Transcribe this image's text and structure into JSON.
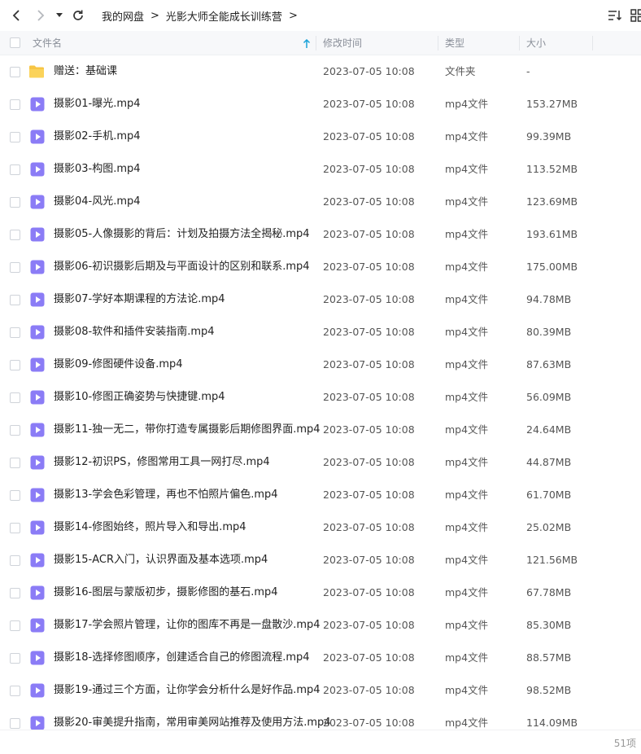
{
  "breadcrumb": [
    "我的网盘",
    "光影大师全能成长训练营"
  ],
  "header": {
    "name": "文件名",
    "mtime": "修改时间",
    "type": "类型",
    "size": "大小"
  },
  "colors": {
    "sort_arrow": "#1aa3d9",
    "video_icon": "#8b7cf6",
    "folder_icon": "#f7c544"
  },
  "rows": [
    {
      "icon": "folder-icon",
      "name": "赠送：基础课",
      "mtime": "2023-07-05 10:08",
      "type": "文件夹",
      "size": "-"
    },
    {
      "icon": "video-file-icon",
      "name": "摄影01-曝光.mp4",
      "mtime": "2023-07-05 10:08",
      "type": "mp4文件",
      "size": "153.27MB"
    },
    {
      "icon": "video-file-icon",
      "name": "摄影02-手机.mp4",
      "mtime": "2023-07-05 10:08",
      "type": "mp4文件",
      "size": "99.39MB"
    },
    {
      "icon": "video-file-icon",
      "name": "摄影03-构图.mp4",
      "mtime": "2023-07-05 10:08",
      "type": "mp4文件",
      "size": "113.52MB"
    },
    {
      "icon": "video-file-icon",
      "name": "摄影04-风光.mp4",
      "mtime": "2023-07-05 10:08",
      "type": "mp4文件",
      "size": "123.69MB"
    },
    {
      "icon": "video-file-icon",
      "name": "摄影05-人像摄影的背后：计划及拍摄方法全揭秘.mp4",
      "mtime": "2023-07-05 10:08",
      "type": "mp4文件",
      "size": "193.61MB"
    },
    {
      "icon": "video-file-icon",
      "name": "摄影06-初识摄影后期及与平面设计的区别和联系.mp4",
      "mtime": "2023-07-05 10:08",
      "type": "mp4文件",
      "size": "175.00MB"
    },
    {
      "icon": "video-file-icon",
      "name": "摄影07-学好本期课程的方法论.mp4",
      "mtime": "2023-07-05 10:08",
      "type": "mp4文件",
      "size": "94.78MB"
    },
    {
      "icon": "video-file-icon",
      "name": "摄影08-软件和插件安装指南.mp4",
      "mtime": "2023-07-05 10:08",
      "type": "mp4文件",
      "size": "80.39MB"
    },
    {
      "icon": "video-file-icon",
      "name": "摄影09-修图硬件设备.mp4",
      "mtime": "2023-07-05 10:08",
      "type": "mp4文件",
      "size": "87.63MB"
    },
    {
      "icon": "video-file-icon",
      "name": "摄影10-修图正确姿势与快捷键.mp4",
      "mtime": "2023-07-05 10:08",
      "type": "mp4文件",
      "size": "56.09MB"
    },
    {
      "icon": "video-file-icon",
      "name": "摄影11-独一无二，带你打造专属摄影后期修图界面.mp4",
      "mtime": "2023-07-05 10:08",
      "type": "mp4文件",
      "size": "24.64MB"
    },
    {
      "icon": "video-file-icon",
      "name": "摄影12-初识PS，修图常用工具一网打尽.mp4",
      "mtime": "2023-07-05 10:08",
      "type": "mp4文件",
      "size": "44.87MB"
    },
    {
      "icon": "video-file-icon",
      "name": "摄影13-学会色彩管理，再也不怕照片偏色.mp4",
      "mtime": "2023-07-05 10:08",
      "type": "mp4文件",
      "size": "61.70MB"
    },
    {
      "icon": "video-file-icon",
      "name": "摄影14-修图始终，照片导入和导出.mp4",
      "mtime": "2023-07-05 10:08",
      "type": "mp4文件",
      "size": "25.02MB"
    },
    {
      "icon": "video-file-icon",
      "name": "摄影15-ACR入门，认识界面及基本选项.mp4",
      "mtime": "2023-07-05 10:08",
      "type": "mp4文件",
      "size": "121.56MB"
    },
    {
      "icon": "video-file-icon",
      "name": "摄影16-图层与蒙版初步，摄影修图的基石.mp4",
      "mtime": "2023-07-05 10:08",
      "type": "mp4文件",
      "size": "67.78MB"
    },
    {
      "icon": "video-file-icon",
      "name": "摄影17-学会照片管理，让你的图库不再是一盘散沙.mp4",
      "mtime": "2023-07-05 10:08",
      "type": "mp4文件",
      "size": "85.30MB"
    },
    {
      "icon": "video-file-icon",
      "name": "摄影18-选择修图顺序，创建适合自己的修图流程.mp4",
      "mtime": "2023-07-05 10:08",
      "type": "mp4文件",
      "size": "88.57MB"
    },
    {
      "icon": "video-file-icon",
      "name": "摄影19-通过三个方面，让你学会分析什么是好作品.mp4",
      "mtime": "2023-07-05 10:08",
      "type": "mp4文件",
      "size": "98.52MB"
    },
    {
      "icon": "video-file-icon",
      "name": "摄影20-审美提升指南，常用审美网站推荐及使用方法.mp4",
      "mtime": "2023-07-05 10:08",
      "type": "mp4文件",
      "size": "114.09MB"
    }
  ],
  "footer": {
    "count": "51项"
  }
}
